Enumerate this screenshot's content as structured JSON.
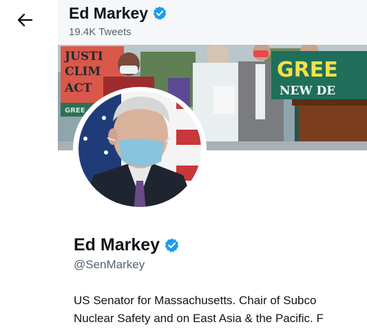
{
  "header": {
    "back_icon": "arrow-left-icon",
    "name": "Ed Markey",
    "tweet_count": "19.4K Tweets",
    "verified_icon": "verified-badge-icon"
  },
  "banner": {
    "sign_left_lines": [
      "JUSTI",
      "CLIM",
      "ACT",
      "GREE"
    ],
    "sign_right_lines": [
      "GREE",
      "NEW DE"
    ]
  },
  "profile": {
    "name": "Ed Markey",
    "handle": "@SenMarkey",
    "bio_lines": [
      "US Senator for Massachusetts. Chair of Subco",
      "Nuclear Safety and on East Asia & the Pacific. F"
    ]
  },
  "colors": {
    "verified": "#1d9bf0",
    "sign_green": "#1f6f5a",
    "sign_yellow": "#f2e24a",
    "handle_gray": "#536471"
  }
}
